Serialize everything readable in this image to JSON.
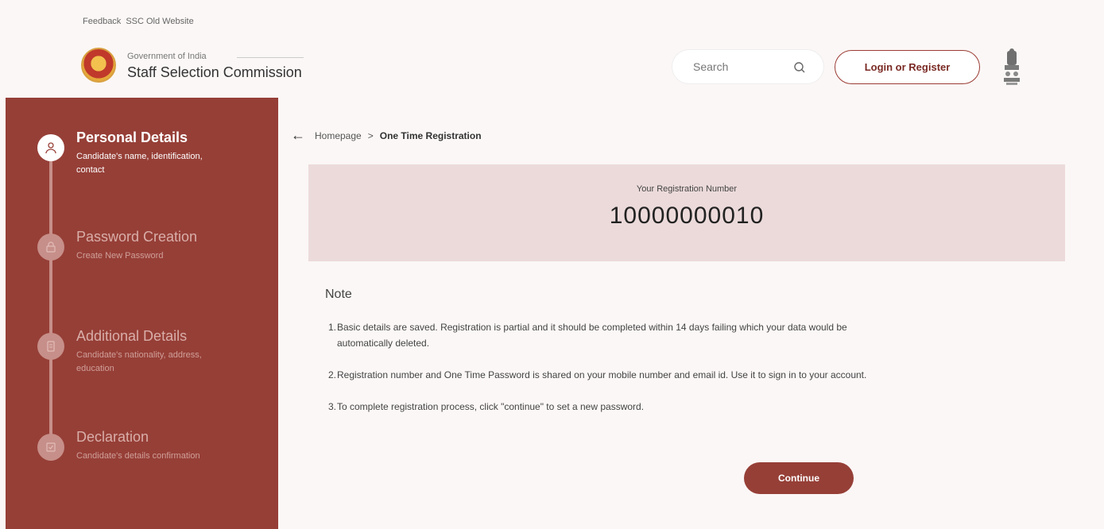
{
  "top_links": {
    "feedback": "Feedback",
    "old_site": "SSC Old Website"
  },
  "header": {
    "org_sub": "Government of India",
    "org_title": "Staff Selection Commission",
    "search_label": "Search",
    "login_label": "Login or Register"
  },
  "steps": [
    {
      "title": "Personal Details",
      "desc": "Candidate's name, identification, contact",
      "active": true
    },
    {
      "title": "Password Creation",
      "desc": "Create New Password",
      "active": false
    },
    {
      "title": "Additional Details",
      "desc": "Candidate's nationality, address, education",
      "active": false
    },
    {
      "title": "Declaration",
      "desc": "Candidate's details confirmation",
      "active": false
    }
  ],
  "breadcrumb": {
    "home": "Homepage",
    "sep": ">",
    "current": "One Time Registration"
  },
  "registration": {
    "label": "Your Registration Number",
    "number": "10000000010"
  },
  "note": {
    "title": "Note",
    "items": [
      {
        "num": "1.",
        "text": "Basic details are saved. Registration is partial and it should be completed within 14 days failing which your data would be automatically deleted."
      },
      {
        "num": "2.",
        "text": "Registration number and One Time Password is shared on your mobile number and email id. Use it to sign in to your account."
      },
      {
        "num": "3.",
        "text": "To complete registration process, click \"continue\" to set a new password."
      }
    ]
  },
  "continue_label": "Continue",
  "colors": {
    "brand": "#963f37",
    "reg_box": "#ecdada"
  }
}
